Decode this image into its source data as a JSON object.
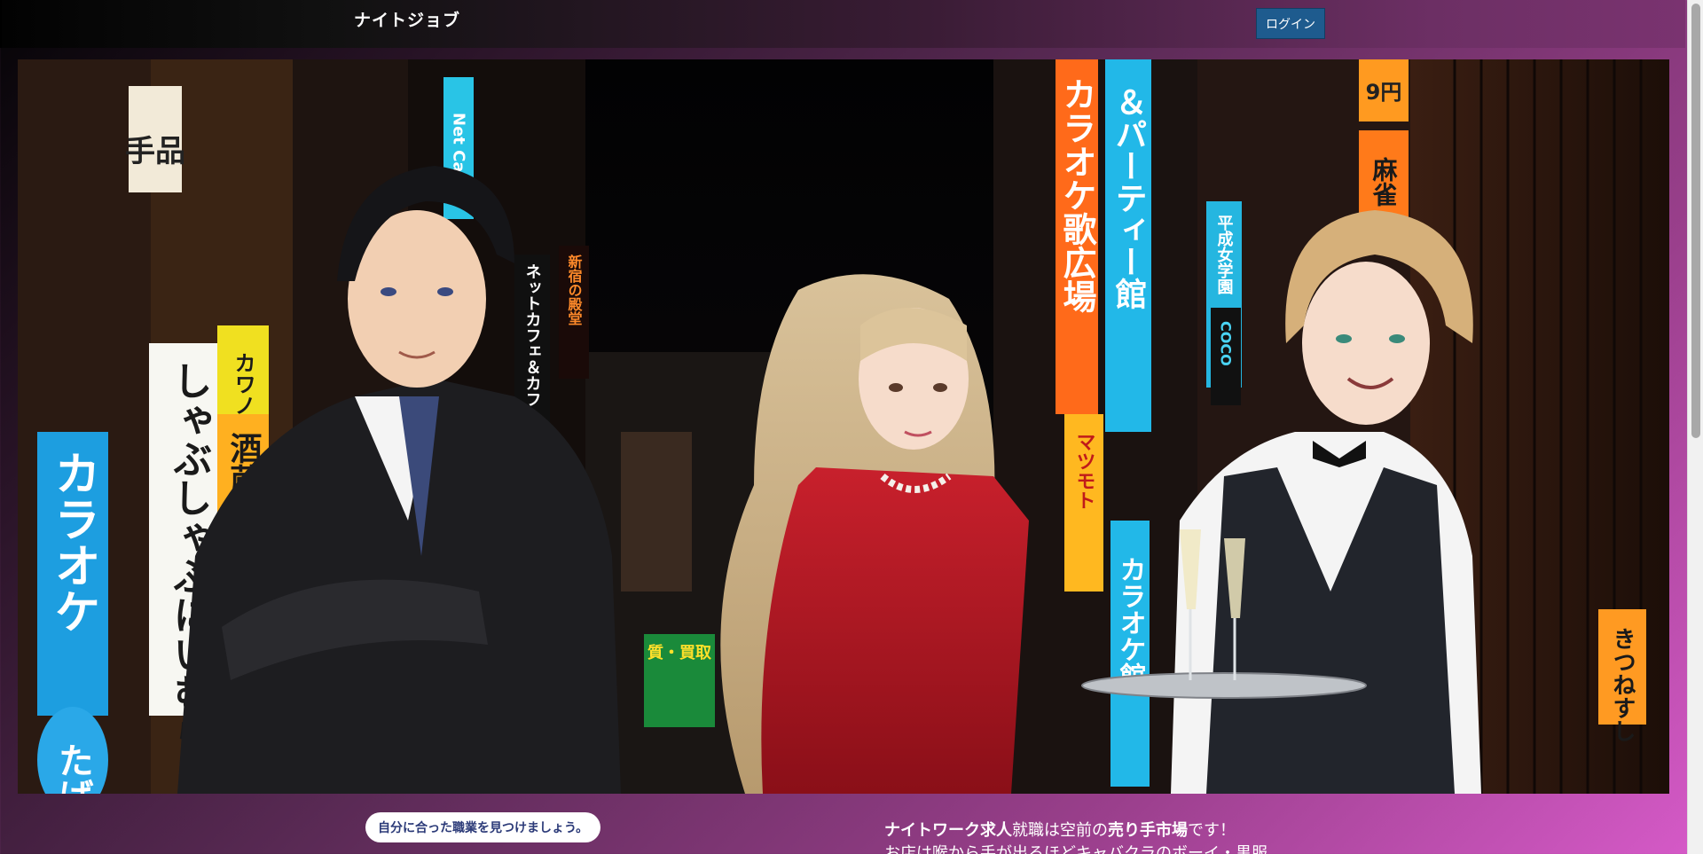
{
  "header": {
    "site_title": "ナイトジョブ",
    "login_label": "ログイン"
  },
  "hero": {
    "signs": {
      "s1": "手品",
      "s2": "Net Ca",
      "s3": "カラオケ歌広場",
      "s4": "＆パーティー館",
      "s5": "9円",
      "s6": "麻雀",
      "s7": "平成女学園",
      "s8": "COCO",
      "s9": "しゃぶしゃぶにいむら",
      "s10": "カラオケ",
      "s11": "たばこ",
      "s12": "酒蔵",
      "s13": "カワノ",
      "s14": "質・買取",
      "s15": "ネットカフェ＆カフ",
      "s16": "新宿の殿堂",
      "s17": "カラオケ館",
      "s18": "きつねすし",
      "s19": "マツモト"
    }
  },
  "cta": {
    "label": "自分に合った職業を見つけましょう。"
  },
  "intro": {
    "line1_a": "ナイトワーク求人",
    "line1_b": "就職は空前の",
    "line1_c": "売り手市場",
    "line1_d": "です！",
    "line2": "お店は喉から手が出るほどキャバクラのボーイ・黒服"
  },
  "colors": {
    "accent": "#1e5b8e",
    "cta_text": "#2b3a78"
  }
}
